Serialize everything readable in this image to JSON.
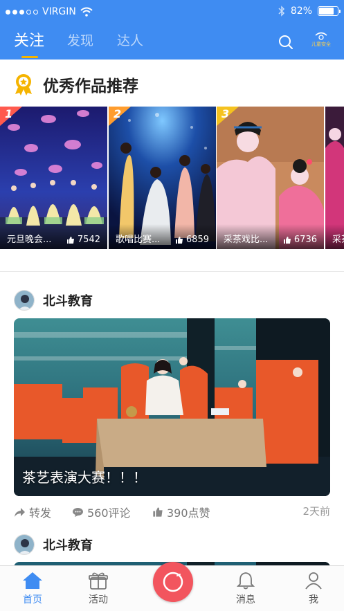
{
  "status_bar": {
    "carrier": "VIRGIN",
    "battery": "82%"
  },
  "top_nav": {
    "tabs": [
      {
        "label": "关注",
        "active": true
      },
      {
        "label": "发现",
        "active": false
      },
      {
        "label": "达人",
        "active": false
      }
    ],
    "kids_safety_label": "儿童安全"
  },
  "recommended": {
    "title": "优秀作品推荐",
    "items": [
      {
        "rank": "1",
        "name": "元旦晚会...",
        "likes": "7542"
      },
      {
        "rank": "2",
        "name": "歌唱比赛...",
        "likes": "6859"
      },
      {
        "rank": "3",
        "name": "采茶戏比...",
        "likes": "6736"
      },
      {
        "rank": "",
        "name": "采茶",
        "likes": ""
      }
    ]
  },
  "feed": [
    {
      "author": "北斗教育",
      "caption": "茶艺表演大赛！！！",
      "share": "转发",
      "comments": "560评论",
      "likes": "390点赞",
      "time": "2天前"
    },
    {
      "author": "北斗教育"
    }
  ],
  "tab_bar": {
    "items": [
      {
        "label": "首页",
        "icon": "home-icon",
        "active": true
      },
      {
        "label": "活动",
        "icon": "gift-icon",
        "active": false
      },
      {
        "label": "消息",
        "icon": "bell-icon",
        "active": false
      },
      {
        "label": "我",
        "icon": "person-icon",
        "active": false
      }
    ]
  },
  "colors": {
    "brand": "#3f8cf2",
    "accent": "#f5b400",
    "record": "#f2555e"
  }
}
